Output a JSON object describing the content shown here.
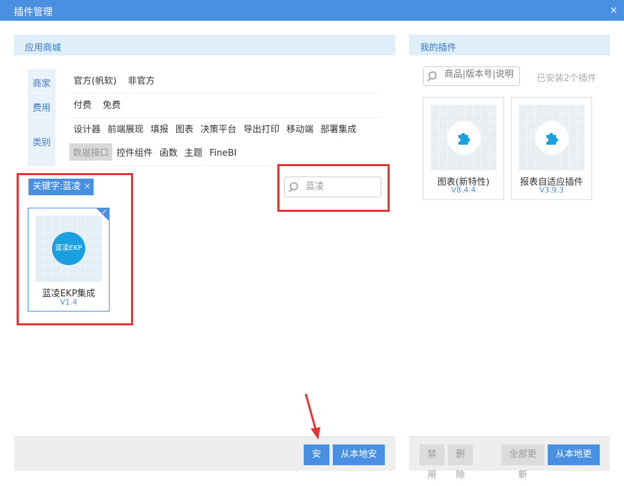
{
  "window": {
    "title": "插件管理",
    "close_icon": "×"
  },
  "store": {
    "header": "应用商城",
    "filters": {
      "vendor_label": "商家",
      "fee_label": "费用",
      "category_label": "类别",
      "vendors": [
        "官方(帆软)",
        "非官方"
      ],
      "fees": [
        "付费",
        "免费"
      ],
      "categories_row1": [
        "设计器",
        "前端展现",
        "填报",
        "图表",
        "决策平台",
        "导出打印",
        "移动端",
        "部署集成"
      ],
      "categories_row2": [
        "数据接口",
        "控件组件",
        "函数",
        "主题",
        "FineBI"
      ]
    },
    "keyword_tag": {
      "label": "关键字:蓝凌",
      "remove_icon": "×"
    },
    "search": {
      "value": "蓝凌"
    },
    "results": [
      {
        "logo_text": "蓝凌EKP",
        "name": "蓝凌EKP集成",
        "version": "V1.4"
      }
    ],
    "footer": {
      "install": "安装",
      "local_install": "从本地安装"
    }
  },
  "my_plugins": {
    "header": "我的插件",
    "search_placeholder": "商品|版本号|说明",
    "installed_count": "已安装2个插件",
    "items": [
      {
        "name": "图表(新特性)",
        "version": "V8.4.4"
      },
      {
        "name": "报表自适应插件",
        "version": "V3.9.3"
      }
    ],
    "footer": {
      "disable": "禁用",
      "delete": "删除",
      "update_all": "全部更新",
      "local_update": "从本地更新"
    }
  },
  "colors": {
    "accent": "#4a90e2",
    "highlight_box": "#e53333"
  }
}
